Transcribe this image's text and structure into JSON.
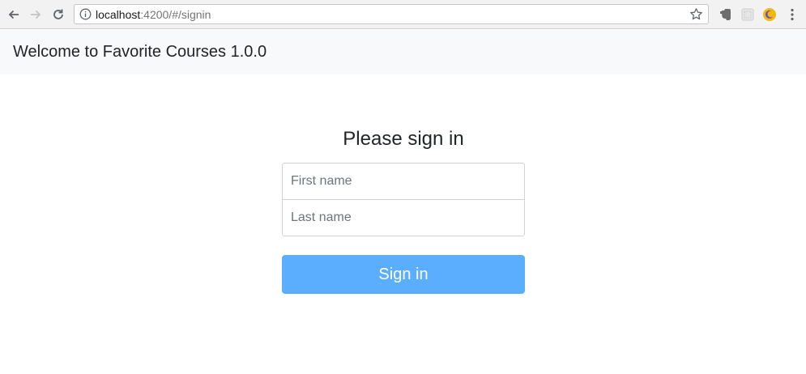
{
  "browser": {
    "url_host": "localhost",
    "url_path": ":4200/#/signin",
    "icons": {
      "back": "back-arrow-icon",
      "forward": "forward-arrow-icon",
      "reload": "reload-icon",
      "info": "info-icon",
      "star": "star-icon",
      "menu": "kebab-menu-icon"
    }
  },
  "navbar": {
    "brand": "Welcome to Favorite Courses 1.0.0",
    "background": "#f8f9fa"
  },
  "signin": {
    "title": "Please sign in",
    "first_name_placeholder": "First name",
    "first_name_value": "",
    "last_name_placeholder": "Last name",
    "last_name_value": "",
    "button_label": "Sign in",
    "button_color": "#5baefd"
  }
}
